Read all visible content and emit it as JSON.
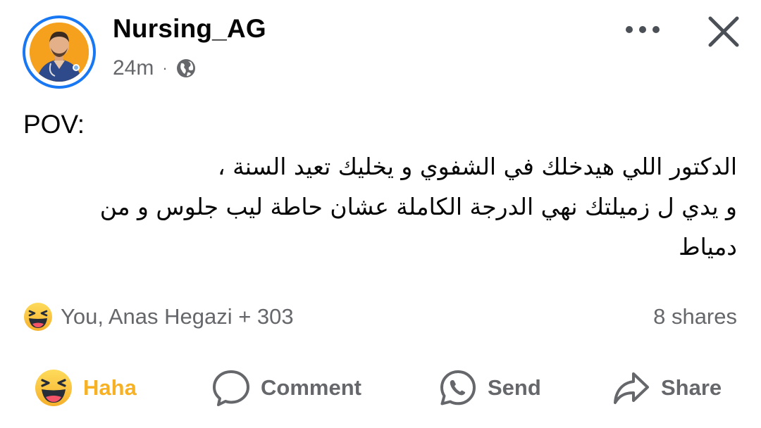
{
  "post": {
    "author": "Nursing_AG",
    "time": "24m",
    "separator": "·",
    "privacy_icon": "globe-icon",
    "pov_label": "POV:",
    "arabic_lines": [
      "الدكتور اللي هيدخلك في الشفوي و يخليك تعيد السنة ،",
      "و يدي ل زميلتك نهي الدرجة الكاملة عشان حاطة ليب جلوس و من",
      "دمياط"
    ]
  },
  "header": {
    "more_icon": "more-horizontal-icon",
    "close_icon": "close-icon"
  },
  "reactions": {
    "icon": "haha-emoji-icon",
    "summary": "You, Anas Hegazi + 303",
    "shares": "8 shares"
  },
  "actions": {
    "haha": "Haha",
    "comment": "Comment",
    "send": "Send",
    "share": "Share"
  },
  "colors": {
    "accent_blue": "#1877f2",
    "haha_yellow": "#f7b125",
    "text_secondary": "#65676b",
    "text_primary": "#050505"
  }
}
